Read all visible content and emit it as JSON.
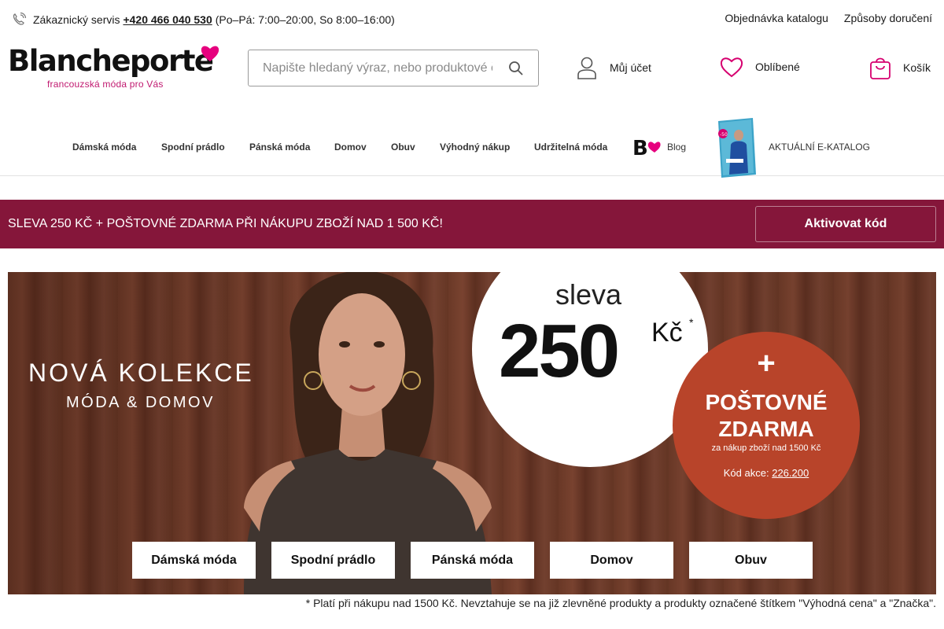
{
  "topbar": {
    "support_label": "Zákaznický servis",
    "phone": "+420 466 040 530",
    "hours": "(Po–Pá: 7:00–20:00, So 8:00–16:00)",
    "links": [
      "Objednávka katalogu",
      "Způsoby doručení"
    ]
  },
  "logo": {
    "brand": "Blancheporte",
    "tagline": "francouzská móda pro Vás",
    "accent_color": "#e6007e"
  },
  "search": {
    "placeholder": "Napište hledaný výraz, nebo produktové č"
  },
  "header": {
    "account": "Můj účet",
    "favorites": "Oblíbené",
    "cart": "Košík"
  },
  "nav": {
    "items": [
      "Dámská móda",
      "Spodní prádlo",
      "Pánská móda",
      "Domov",
      "Obuv",
      "Výhodný nákup",
      "Udržitelná móda"
    ],
    "blog": "Blog",
    "ecatalog": "AKTUÁLNÍ E-KATALOG"
  },
  "promo": {
    "text": "SLEVA 250 KČ + POŠTOVNÉ ZDARMA PŘI NÁKUPU ZBOŽÍ NAD 1 500 KČ!",
    "button": "Aktivovat kód",
    "bg_color": "#85163a"
  },
  "hero": {
    "title": "NOVÁ KOLEKCE",
    "subtitle": "MÓDA & DOMOV",
    "discount_word": "sleva",
    "discount_value": "250",
    "currency": "Kč",
    "asterisk": "*",
    "plus": "+",
    "shipping_line1": "POŠTOVNÉ",
    "shipping_line2": "ZDARMA",
    "shipping_note": "za nákup zboží nad 1500 Kč",
    "code_label": "Kód akce:",
    "code": "226.200",
    "category_buttons": [
      "Dámská móda",
      "Spodní prádlo",
      "Pánská móda",
      "Domov",
      "Obuv"
    ]
  },
  "footnote": "* Platí při nákupu nad 1500 Kč. Nevztahuje se na již zlevněné produkty a produkty označené štítkem \"Výhodná cena\" a \"Značka\"."
}
